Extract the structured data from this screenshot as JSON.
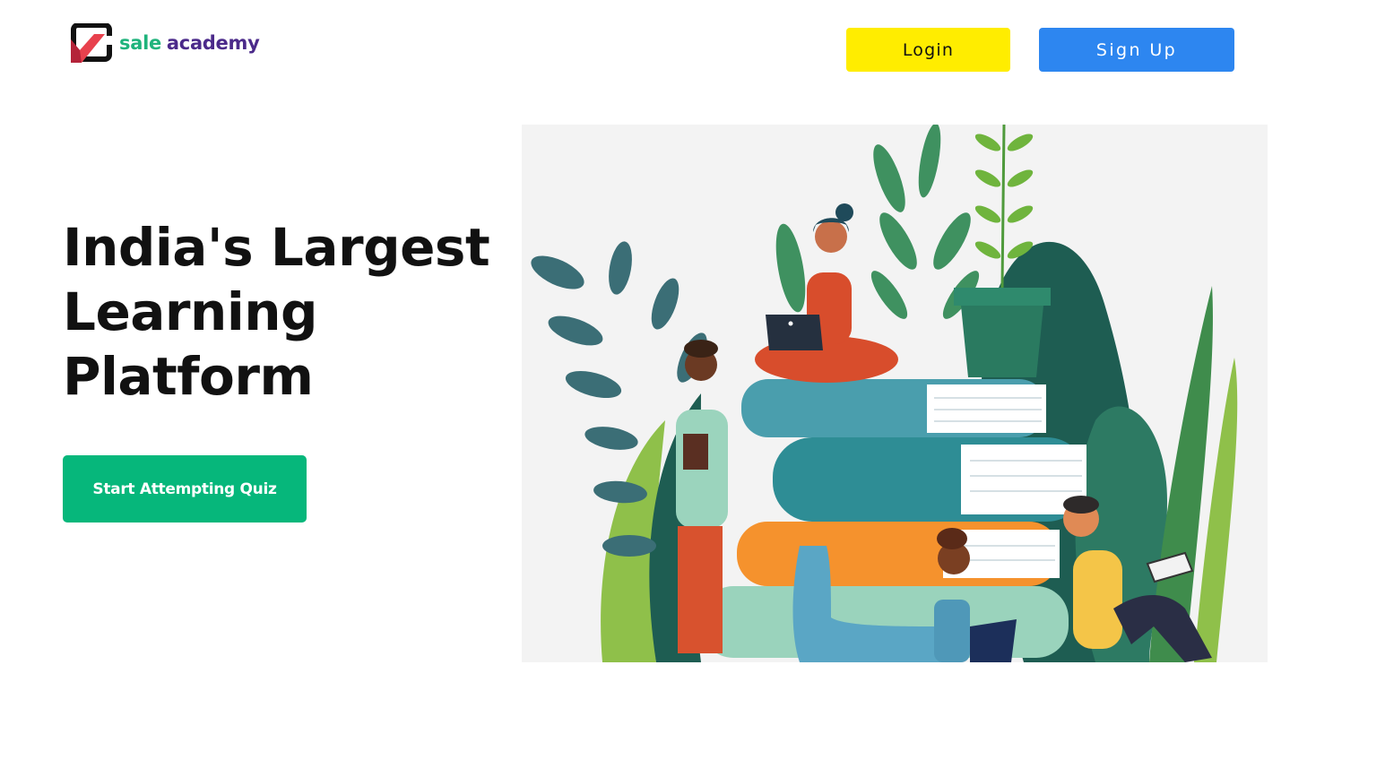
{
  "brand": {
    "sale": "sale",
    "academy": "academy"
  },
  "nav": {
    "login_label": "Login",
    "signup_label": "Sign Up"
  },
  "hero": {
    "headline_lines": [
      "India's Largest",
      "Learning",
      "Platform"
    ],
    "cta_label": "Start Attempting Quiz"
  },
  "colors": {
    "login_bg": "#ffed00",
    "signup_bg": "#2d86f0",
    "cta_bg": "#06b77b",
    "brand_green": "#1fb37c",
    "brand_purple": "#4b2a8a"
  },
  "icons": {
    "logo": "sale-academy-logo-icon"
  }
}
